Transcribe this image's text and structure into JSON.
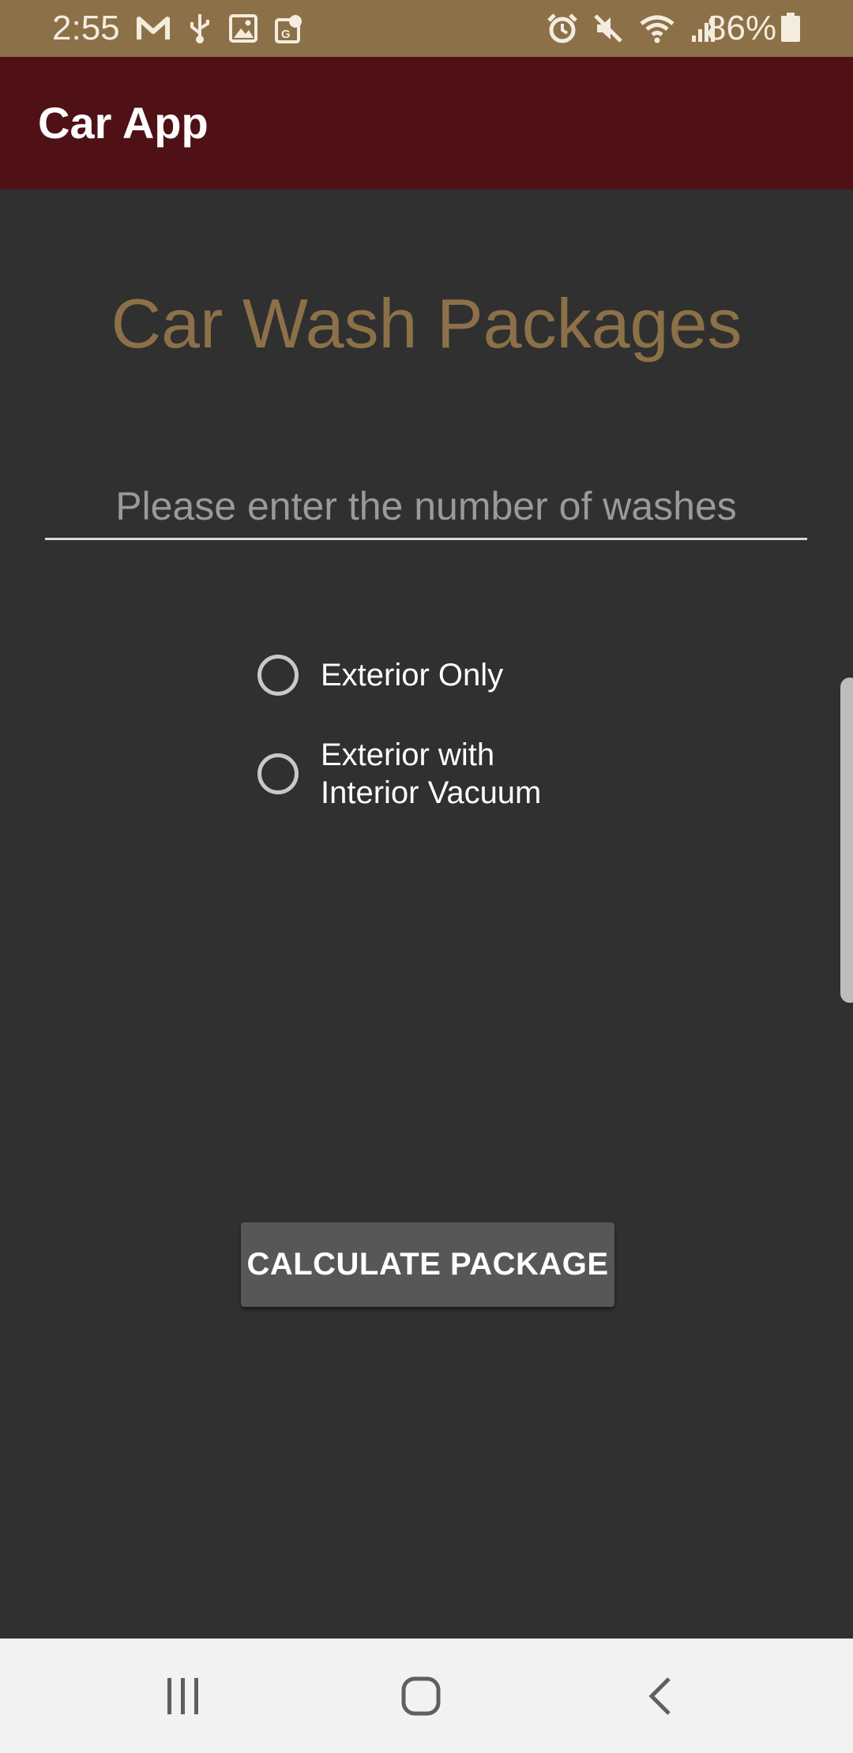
{
  "status_bar": {
    "time": "2:55",
    "battery_percent": "86%",
    "left_icons": [
      "gmail-icon",
      "usb-icon",
      "gallery-icon",
      "maps-icon"
    ],
    "right_icons": [
      "alarm-icon",
      "mute-icon",
      "wifi-icon",
      "signal-icon",
      "battery-icon"
    ],
    "background_color": "#8c7148"
  },
  "app_bar": {
    "title": "Car App",
    "background_color": "#501116"
  },
  "main": {
    "page_title": "Car Wash Packages",
    "washes_input": {
      "value": "",
      "placeholder": "Please enter the number of washes"
    },
    "radio_options": [
      {
        "label": "Exterior Only",
        "selected": false
      },
      {
        "label": "Exterior with\nInterior Vacuum",
        "selected": false
      }
    ],
    "calculate_button_label": "CALCULATE PACKAGE",
    "accent_color": "#8c7148",
    "background_color": "#303030"
  },
  "nav_bar": {
    "buttons": [
      "recent-apps-icon",
      "home-icon",
      "back-icon"
    ]
  }
}
